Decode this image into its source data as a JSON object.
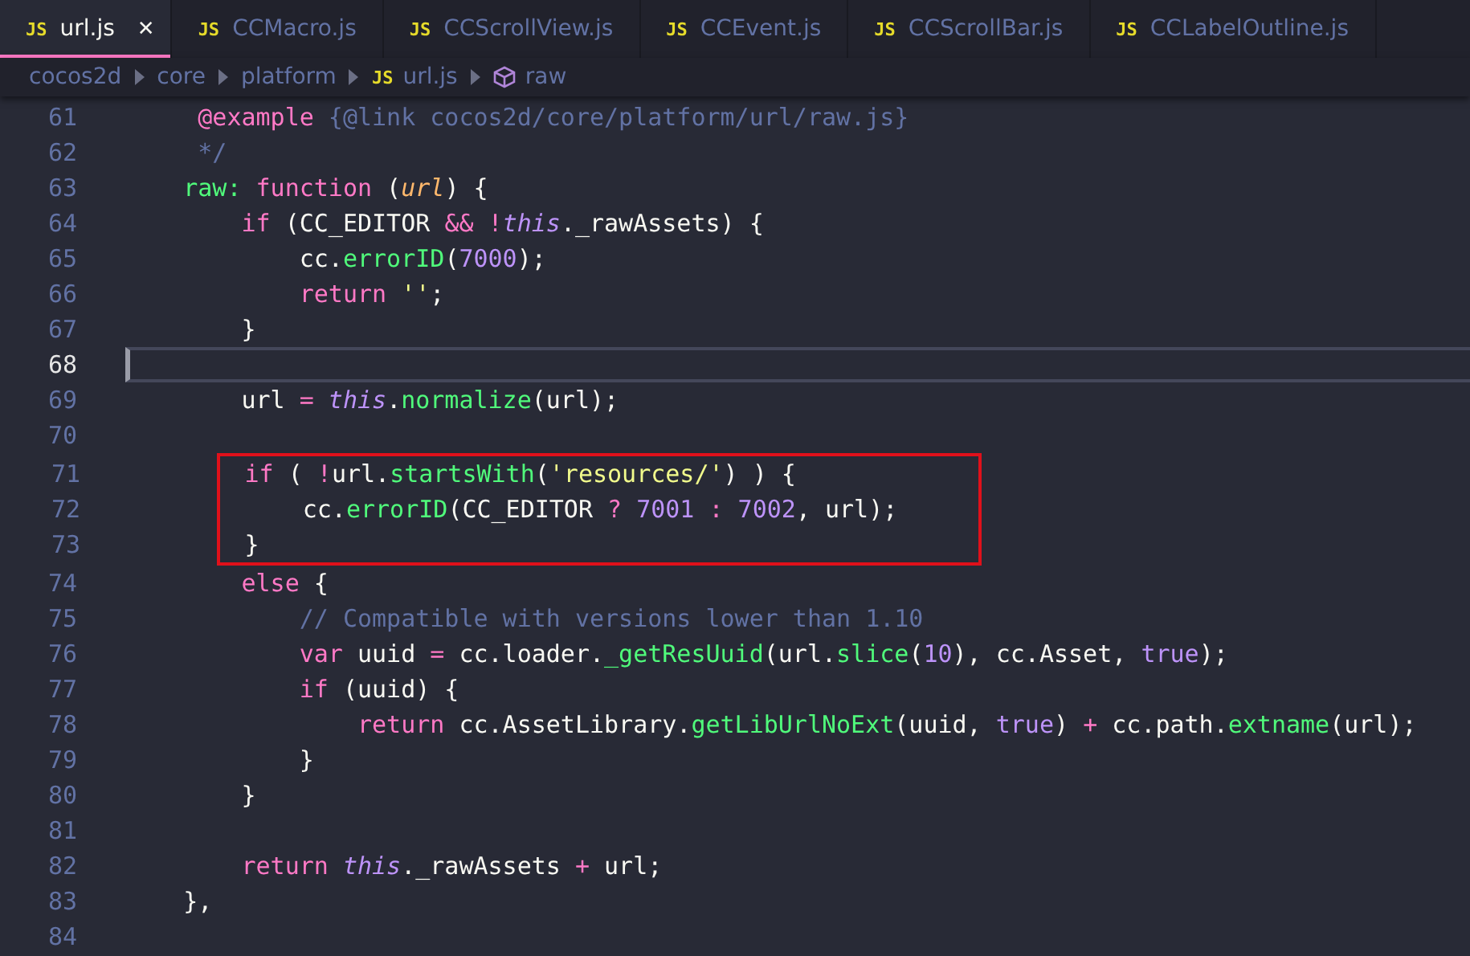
{
  "tabs": [
    {
      "label": "url.js",
      "icon": "JS",
      "selected": true
    },
    {
      "label": "CCMacro.js",
      "icon": "JS",
      "selected": false
    },
    {
      "label": "CCScrollView.js",
      "icon": "JS",
      "selected": false
    },
    {
      "label": "CCEvent.js",
      "icon": "JS",
      "selected": false
    },
    {
      "label": "CCScrollBar.js",
      "icon": "JS",
      "selected": false
    },
    {
      "label": "CCLabelOutline.js",
      "icon": "JS",
      "selected": false
    }
  ],
  "close_button": "✕",
  "breadcrumb": [
    {
      "kind": "folder",
      "label": "cocos2d"
    },
    {
      "kind": "folder",
      "label": "core"
    },
    {
      "kind": "folder",
      "label": "platform"
    },
    {
      "kind": "file",
      "label": "url.js",
      "icon": "JS"
    },
    {
      "kind": "symbol",
      "label": "raw"
    }
  ],
  "lines": [
    {
      "number": "61",
      "current": false,
      "boxed": false,
      "tokens": [
        {
          "kind": "keyword",
          "text": "     @example"
        },
        {
          "kind": "comment",
          "text": " {@link cocos2d/core/platform/url/raw.js}"
        }
      ]
    },
    {
      "number": "62",
      "current": false,
      "boxed": false,
      "tokens": [
        {
          "kind": "comment",
          "text": "     */"
        }
      ]
    },
    {
      "number": "63",
      "current": false,
      "boxed": false,
      "tokens": [
        {
          "kind": "func",
          "text": "    raw:"
        },
        {
          "kind": "keyword",
          "text": " function"
        },
        {
          "kind": "plain",
          "text": " ("
        },
        {
          "kind": "param",
          "text": "url"
        },
        {
          "kind": "plain",
          "text": ") {"
        }
      ]
    },
    {
      "number": "64",
      "current": false,
      "boxed": false,
      "tokens": [
        {
          "kind": "keyword",
          "text": "        if"
        },
        {
          "kind": "plain",
          "text": " (CC_EDITOR "
        },
        {
          "kind": "keyword",
          "text": "&& !"
        },
        {
          "kind": "this",
          "text": "this"
        },
        {
          "kind": "plain",
          "text": "._rawAssets) {"
        }
      ]
    },
    {
      "number": "65",
      "current": false,
      "boxed": false,
      "tokens": [
        {
          "kind": "plain",
          "text": "            cc."
        },
        {
          "kind": "func",
          "text": "errorID"
        },
        {
          "kind": "plain",
          "text": "("
        },
        {
          "kind": "number",
          "text": "7000"
        },
        {
          "kind": "plain",
          "text": ");"
        }
      ]
    },
    {
      "number": "66",
      "current": false,
      "boxed": false,
      "tokens": [
        {
          "kind": "keyword",
          "text": "            return"
        },
        {
          "kind": "string",
          "text": " ''"
        },
        {
          "kind": "plain",
          "text": ";"
        }
      ]
    },
    {
      "number": "67",
      "current": false,
      "boxed": false,
      "tokens": [
        {
          "kind": "plain",
          "text": "        }"
        }
      ]
    },
    {
      "number": "68",
      "current": true,
      "boxed": false
    },
    {
      "number": "69",
      "current": false,
      "boxed": false,
      "tokens": [
        {
          "kind": "plain",
          "text": "        url "
        },
        {
          "kind": "keyword",
          "text": "="
        },
        {
          "kind": "this",
          "text": " this"
        },
        {
          "kind": "plain",
          "text": "."
        },
        {
          "kind": "func",
          "text": "normalize"
        },
        {
          "kind": "plain",
          "text": "(url);"
        }
      ]
    },
    {
      "number": "70",
      "current": false,
      "boxed": false
    },
    {
      "number": "71",
      "current": false,
      "boxed": true,
      "tokens": [
        {
          "kind": "keyword",
          "text": "        if"
        },
        {
          "kind": "plain",
          "text": " ( "
        },
        {
          "kind": "keyword",
          "text": "!"
        },
        {
          "kind": "plain",
          "text": "url."
        },
        {
          "kind": "func",
          "text": "startsWith"
        },
        {
          "kind": "plain",
          "text": "("
        },
        {
          "kind": "string",
          "text": "'resources/'"
        },
        {
          "kind": "plain",
          "text": ") ) {"
        }
      ]
    },
    {
      "number": "72",
      "current": false,
      "boxed": true,
      "tokens": [
        {
          "kind": "plain",
          "text": "            cc."
        },
        {
          "kind": "func",
          "text": "errorID"
        },
        {
          "kind": "plain",
          "text": "(CC_EDITOR "
        },
        {
          "kind": "keyword",
          "text": "?"
        },
        {
          "kind": "number",
          "text": " 7001"
        },
        {
          "kind": "keyword",
          "text": " :"
        },
        {
          "kind": "number",
          "text": " 7002"
        },
        {
          "kind": "plain",
          "text": ", url);"
        }
      ]
    },
    {
      "number": "73",
      "current": false,
      "boxed": true,
      "tokens": [
        {
          "kind": "plain",
          "text": "        }"
        }
      ]
    },
    {
      "number": "74",
      "current": false,
      "boxed": false,
      "tokens": [
        {
          "kind": "keyword",
          "text": "        else"
        },
        {
          "kind": "plain",
          "text": " {"
        }
      ]
    },
    {
      "number": "75",
      "current": false,
      "boxed": false,
      "tokens": [
        {
          "kind": "comment",
          "text": "            // Compatible with versions lower than 1.10"
        }
      ]
    },
    {
      "number": "76",
      "current": false,
      "boxed": false,
      "tokens": [
        {
          "kind": "keyword",
          "text": "            var"
        },
        {
          "kind": "plain",
          "text": " uuid "
        },
        {
          "kind": "keyword",
          "text": "="
        },
        {
          "kind": "plain",
          "text": " cc.loader."
        },
        {
          "kind": "func",
          "text": "_getResUuid"
        },
        {
          "kind": "plain",
          "text": "(url."
        },
        {
          "kind": "func",
          "text": "slice"
        },
        {
          "kind": "plain",
          "text": "("
        },
        {
          "kind": "number",
          "text": "10"
        },
        {
          "kind": "plain",
          "text": "), cc.Asset, "
        },
        {
          "kind": "number",
          "text": "true"
        },
        {
          "kind": "plain",
          "text": ");"
        }
      ]
    },
    {
      "number": "77",
      "current": false,
      "boxed": false,
      "tokens": [
        {
          "kind": "keyword",
          "text": "            if"
        },
        {
          "kind": "plain",
          "text": " (uuid) {"
        }
      ]
    },
    {
      "number": "78",
      "current": false,
      "boxed": false,
      "tokens": [
        {
          "kind": "keyword",
          "text": "                return"
        },
        {
          "kind": "plain",
          "text": " cc.AssetLibrary."
        },
        {
          "kind": "func",
          "text": "getLibUrlNoExt"
        },
        {
          "kind": "plain",
          "text": "(uuid, "
        },
        {
          "kind": "number",
          "text": "true"
        },
        {
          "kind": "plain",
          "text": ") "
        },
        {
          "kind": "keyword",
          "text": "+"
        },
        {
          "kind": "plain",
          "text": " cc.path."
        },
        {
          "kind": "func",
          "text": "extname"
        },
        {
          "kind": "plain",
          "text": "(url);"
        }
      ]
    },
    {
      "number": "79",
      "current": false,
      "boxed": false,
      "tokens": [
        {
          "kind": "plain",
          "text": "            }"
        }
      ]
    },
    {
      "number": "80",
      "current": false,
      "boxed": false,
      "tokens": [
        {
          "kind": "plain",
          "text": "        }"
        }
      ]
    },
    {
      "number": "81",
      "current": false,
      "boxed": false
    },
    {
      "number": "82",
      "current": false,
      "boxed": false,
      "tokens": [
        {
          "kind": "keyword",
          "text": "        return"
        },
        {
          "kind": "this",
          "text": " this"
        },
        {
          "kind": "plain",
          "text": "._rawAssets "
        },
        {
          "kind": "keyword",
          "text": "+"
        },
        {
          "kind": "plain",
          "text": " url;"
        }
      ]
    },
    {
      "number": "83",
      "current": false,
      "boxed": false,
      "tokens": [
        {
          "kind": "plain",
          "text": "    },"
        }
      ]
    },
    {
      "number": "84",
      "current": false,
      "boxed": false
    }
  ]
}
